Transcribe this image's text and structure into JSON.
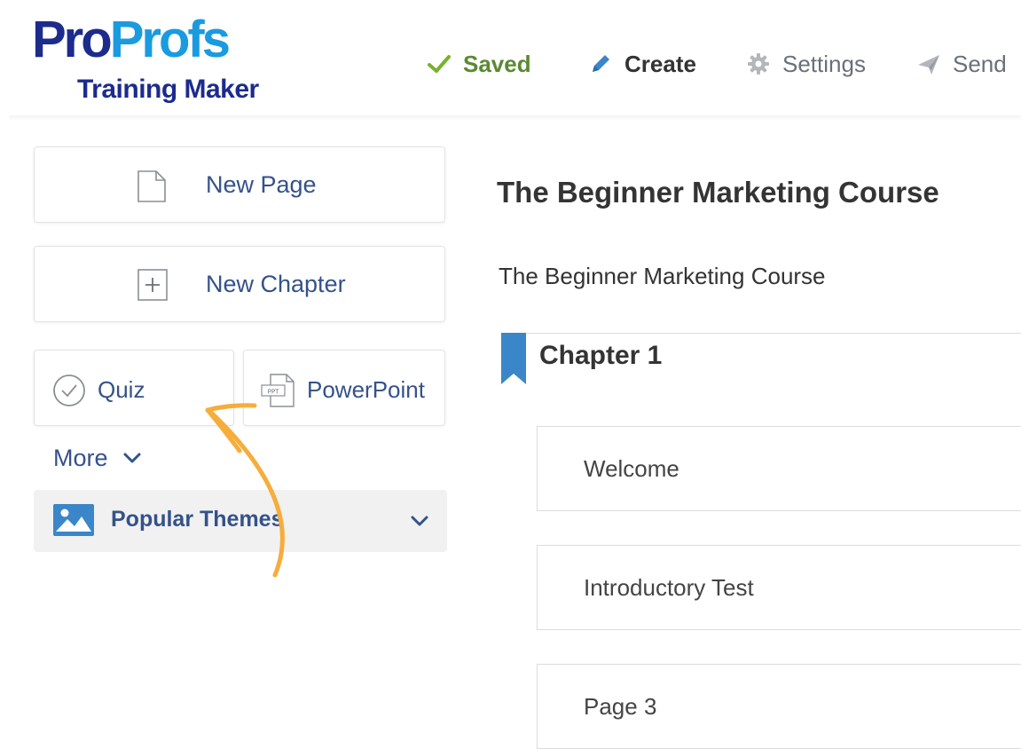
{
  "header": {
    "logo": {
      "pro": "Pro",
      "profs": "Profs",
      "subtitle": "Training Maker"
    },
    "nav": {
      "saved": "Saved",
      "create": "Create",
      "settings": "Settings",
      "send": "Send"
    }
  },
  "sidebar": {
    "new_page": "New Page",
    "new_chapter": "New Chapter",
    "quiz": "Quiz",
    "powerpoint": "PowerPoint",
    "ppt_icon_text": "PPT",
    "more": "More",
    "popular_themes": "Popular Themes"
  },
  "content": {
    "course_title": "The Beginner Marketing Course",
    "course_description": "The Beginner Marketing Course",
    "chapter": {
      "title": "Chapter 1",
      "pages": [
        "Welcome",
        "Introductory Test",
        "Page 3"
      ]
    }
  },
  "colors": {
    "brand_dark_blue": "#1c2b8c",
    "brand_light_blue": "#1a9be0",
    "saved_green": "#5a8a32",
    "link_blue": "#34528a",
    "bookmark_blue": "#3b86c8",
    "annotation_orange": "#f6ad3c"
  },
  "icons": {
    "saved": "checkmark-icon",
    "create": "pencil-icon",
    "settings": "gear-icon",
    "send": "paper-plane-icon",
    "new_page": "document-icon",
    "new_chapter": "plus-box-icon",
    "quiz": "check-circle-icon",
    "powerpoint": "ppt-file-icon",
    "more": "chevron-down-icon",
    "themes": "image-icon",
    "chapter": "bookmark-icon"
  }
}
